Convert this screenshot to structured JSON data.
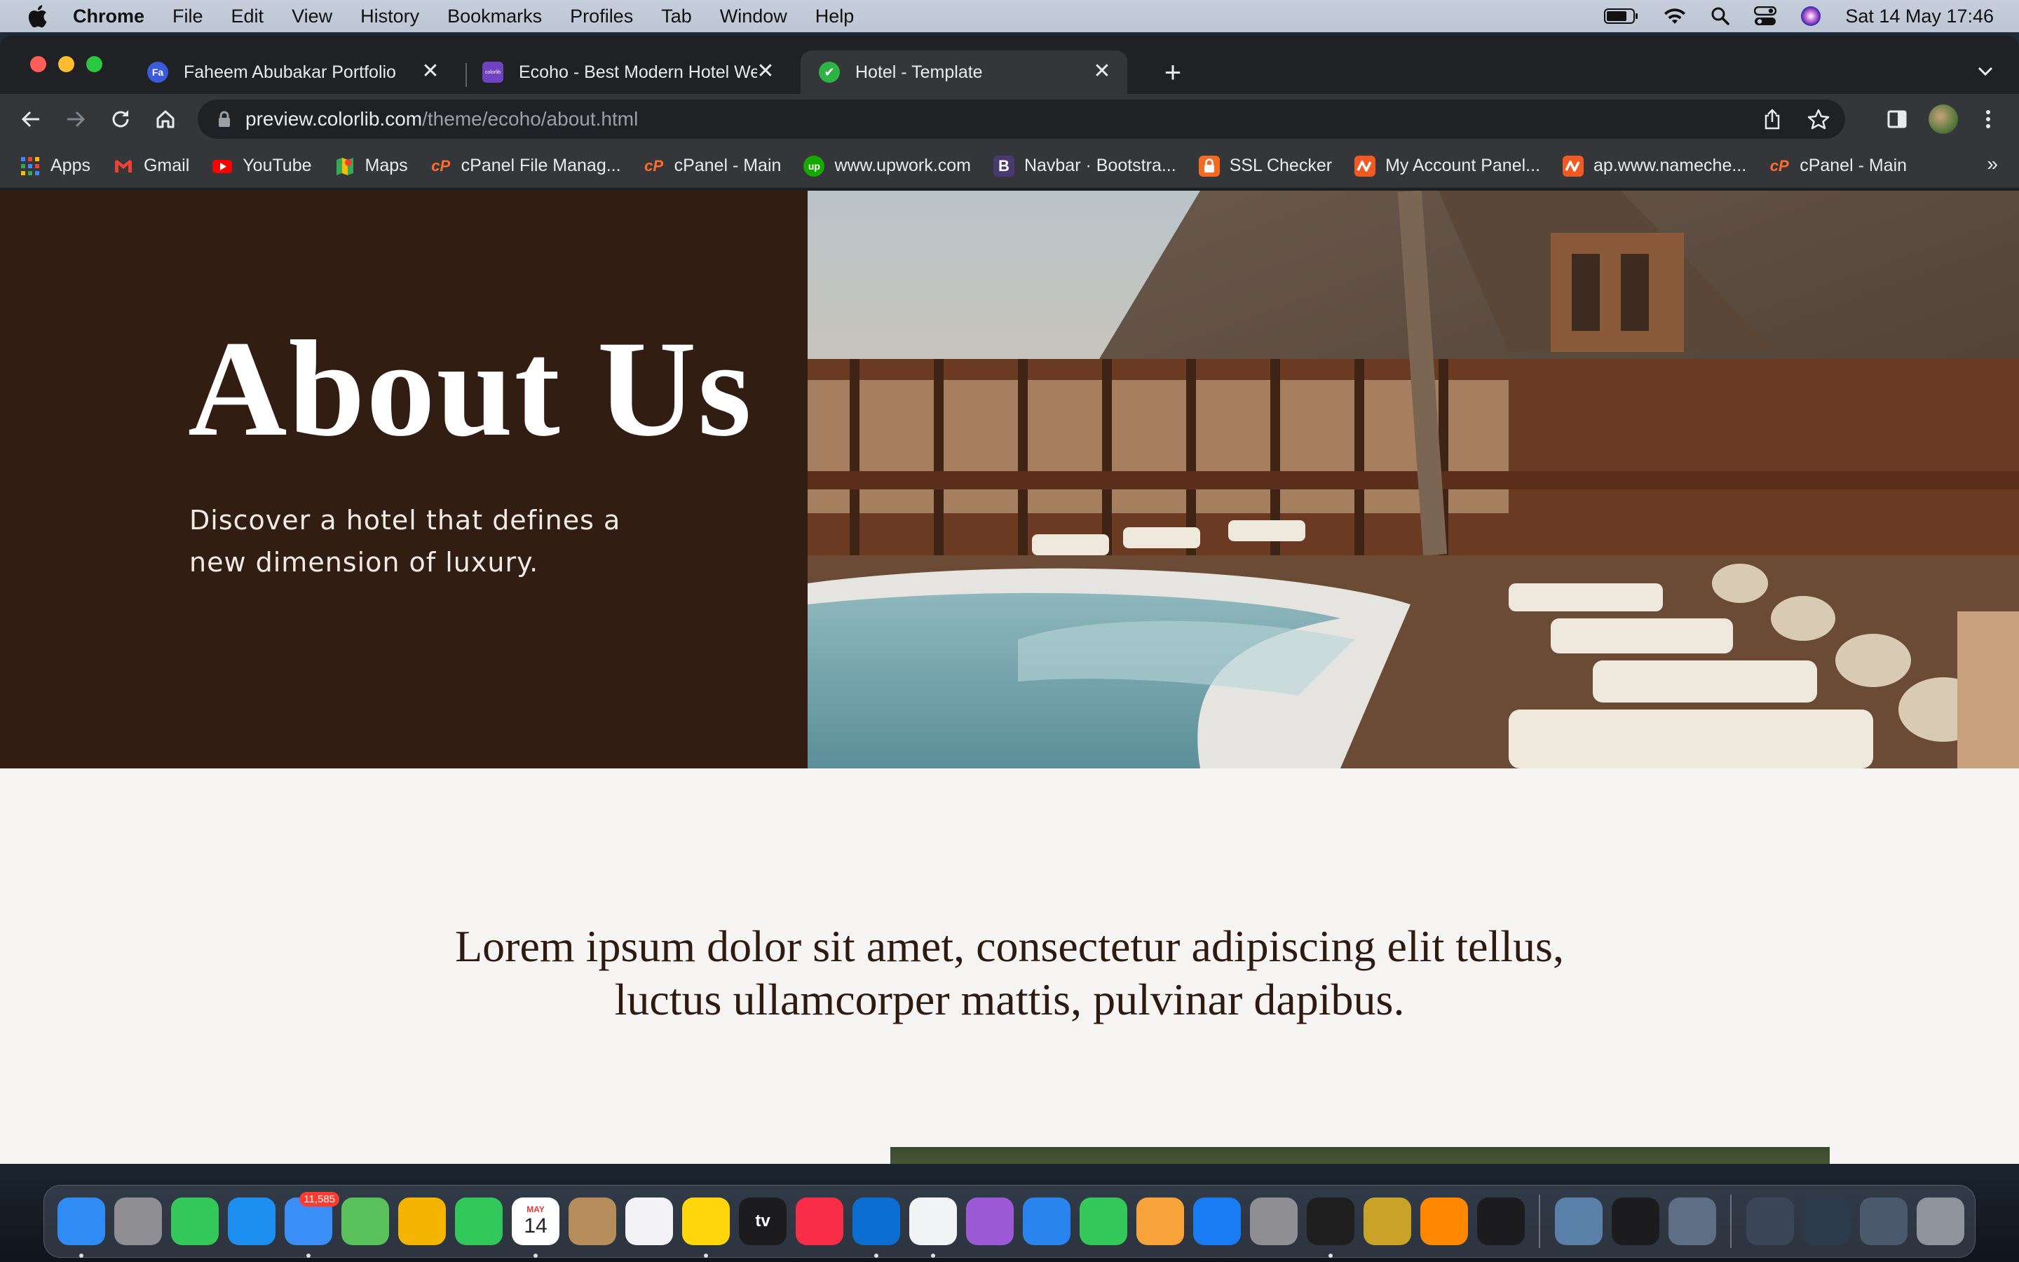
{
  "menubar": {
    "app_name": "Chrome",
    "items": [
      "File",
      "Edit",
      "View",
      "History",
      "Bookmarks",
      "Profiles",
      "Tab",
      "Window",
      "Help"
    ],
    "clock": "Sat 14 May  17:46"
  },
  "browser": {
    "tabs": [
      {
        "title": "Faheem Abubakar Portfolio",
        "favicon_label": "Fa",
        "favicon_color": "#3b5bdb"
      },
      {
        "title": "Ecoho - Best Modern Hotel We",
        "favicon_label": "colorlib",
        "favicon_color": "#6f42c1"
      },
      {
        "title": "Hotel - Template",
        "favicon_label": "✔",
        "favicon_color": "#2fb344"
      }
    ],
    "close_glyph": "✕",
    "new_tab_glyph": "+",
    "url_host": "preview.colorlib.com",
    "url_path": "/theme/ecoho/about.html",
    "bookmarks": [
      {
        "label": "Apps",
        "icon": "apps-grid-icon",
        "color": "#4285f4"
      },
      {
        "label": "Gmail",
        "icon": "gmail-icon",
        "color": "#ea4335"
      },
      {
        "label": "YouTube",
        "icon": "youtube-icon",
        "color": "#ff0000"
      },
      {
        "label": "Maps",
        "icon": "maps-icon",
        "color": "#34a853"
      },
      {
        "label": "cPanel File Manag...",
        "icon": "cpanel-icon",
        "color": "#ff6c2c"
      },
      {
        "label": "cPanel - Main",
        "icon": "cpanel-icon",
        "color": "#ff6c2c"
      },
      {
        "label": "www.upwork.com",
        "icon": "upwork-icon",
        "color": "#14a800"
      },
      {
        "label": "Navbar · Bootstra...",
        "icon": "bootstrap-icon",
        "color": "#7952b3"
      },
      {
        "label": "SSL Checker",
        "icon": "ssl-lock-icon",
        "color": "#f26b21"
      },
      {
        "label": "My Account Panel...",
        "icon": "namecheap-icon",
        "color": "#f15a22"
      },
      {
        "label": "ap.www.nameche...",
        "icon": "namecheap-icon",
        "color": "#f15a22"
      },
      {
        "label": "cPanel - Main",
        "icon": "cpanel-icon",
        "color": "#ff6c2c"
      }
    ],
    "more_glyph": "»"
  },
  "page": {
    "hero_title": "About Us",
    "hero_subtitle": "Discover a hotel that defines a new dimension of luxury.",
    "intro": "Lorem ipsum dolor sit amet, consectetur adipiscing elit tellus, luctus ullamcorper mattis, pulvinar dapibus.",
    "colors": {
      "hero_bg": "#321d13",
      "page_bg": "#f6f5f4",
      "heading": "#2f1a10"
    }
  },
  "dock": {
    "apps": [
      {
        "name": "finder-icon",
        "color": "#2f8cf5",
        "running": true
      },
      {
        "name": "launchpad-icon",
        "color": "#8e8e93",
        "running": false
      },
      {
        "name": "messages-icon",
        "color": "#34c759",
        "running": false
      },
      {
        "name": "safari-icon",
        "color": "#1d8ff0",
        "running": false
      },
      {
        "name": "mail-icon",
        "color": "#3a8ef6",
        "running": true,
        "badge": "11,585"
      },
      {
        "name": "maps-icon",
        "color": "#5ac05a",
        "running": false
      },
      {
        "name": "photos-icon",
        "color": "#f4b400",
        "running": false
      },
      {
        "name": "facetime-icon",
        "color": "#30c85a",
        "running": false
      },
      {
        "name": "calendar-icon",
        "color": "#ffffff",
        "running": true,
        "label": "14",
        "sub": "MAY"
      },
      {
        "name": "contacts-icon",
        "color": "#b58c5a",
        "running": false
      },
      {
        "name": "reminders-icon",
        "color": "#f2f2f7",
        "running": false
      },
      {
        "name": "notes-icon",
        "color": "#ffd60a",
        "running": true
      },
      {
        "name": "apple-tv-icon",
        "color": "#1c1c1e",
        "running": false,
        "label": "tv"
      },
      {
        "name": "music-icon",
        "color": "#fa2d48",
        "running": false
      },
      {
        "name": "vscode-icon",
        "color": "#0d6ed1",
        "running": true
      },
      {
        "name": "chrome-icon",
        "color": "#f1f3f4",
        "running": true
      },
      {
        "name": "podcasts-icon",
        "color": "#9b59d6",
        "running": false
      },
      {
        "name": "keynote-icon",
        "color": "#2a84f0",
        "running": false
      },
      {
        "name": "numbers-icon",
        "color": "#34c759",
        "running": false
      },
      {
        "name": "pages-icon",
        "color": "#f8a23a",
        "running": false
      },
      {
        "name": "app-store-icon",
        "color": "#1a7cf5",
        "running": false
      },
      {
        "name": "system-preferences-icon",
        "color": "#8e8e93",
        "running": false
      },
      {
        "name": "figma-icon",
        "color": "#1e1e1e",
        "running": true
      },
      {
        "name": "archive-utility-icon",
        "color": "#c9a227",
        "running": false
      },
      {
        "name": "vlc-icon",
        "color": "#ff8800",
        "running": false
      },
      {
        "name": "terminal-icon",
        "color": "#1c1c1e",
        "running": false
      }
    ],
    "extras": [
      {
        "name": "preview-icon",
        "color": "#5a7fa8"
      },
      {
        "name": "activity-monitor-icon",
        "color": "#1c1c1e"
      },
      {
        "name": "quicktime-icon",
        "color": "#5c6f84"
      }
    ],
    "stacks": [
      {
        "name": "desktop-stack-icon",
        "color": "#3a4656"
      },
      {
        "name": "downloads-stack-icon",
        "color": "#2d3a4a"
      },
      {
        "name": "screenshots-stack-icon",
        "color": "#4a5a6c"
      },
      {
        "name": "trash-icon",
        "color": "#8e949c"
      }
    ]
  }
}
